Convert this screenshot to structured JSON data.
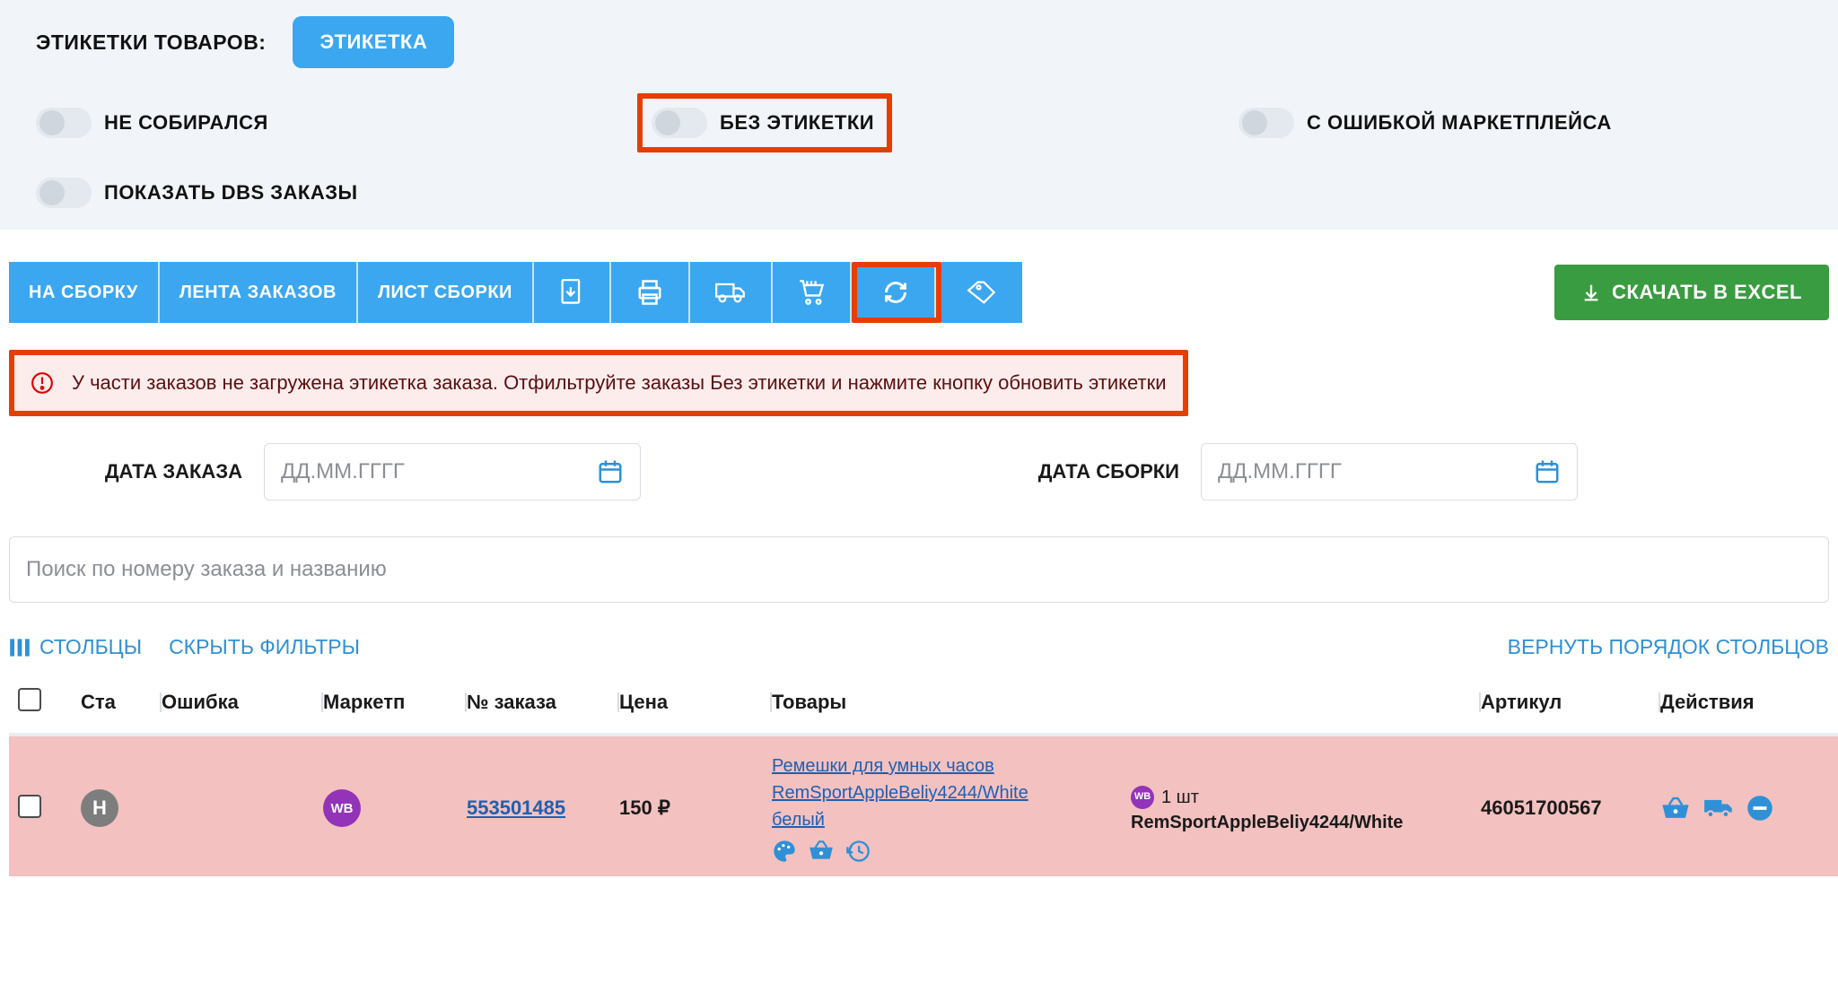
{
  "filters": {
    "labels_title": "ЭТИКЕТКИ ТОВАРОВ:",
    "label_button": "ЭТИКЕТКА",
    "toggle_not_assembled": "НЕ СОБИРАЛСЯ",
    "toggle_no_label": "БЕЗ ЭТИКЕТКИ",
    "toggle_mp_error": "С ОШИБКОЙ МАРКЕТПЛЕЙСА",
    "toggle_dbs": "ПОКАЗАТЬ DBS ЗАКАЗЫ"
  },
  "toolbar": {
    "to_assembly": "НА СБОРКУ",
    "orders_feed": "ЛЕНТА ЗАКАЗОВ",
    "assembly_list": "ЛИСТ СБОРКИ",
    "download_excel": "СКАЧАТЬ В EXCEL"
  },
  "alert": {
    "text": "У части заказов не загружена этикетка заказа. Отфильтруйте заказы Без этикетки и нажмите кнопку обновить этикетки"
  },
  "dates": {
    "order_label": "ДАТА ЗАКАЗА",
    "assembly_label": "ДАТА СБОРКИ",
    "placeholder": "ДД.ММ.ГГГГ"
  },
  "search": {
    "placeholder": "Поиск по номеру заказа и названию"
  },
  "table_controls": {
    "columns": "СТОЛБЦЫ",
    "hide_filters": "СКРЫТЬ ФИЛЬТРЫ",
    "reset_order": "ВЕРНУТЬ ПОРЯДОК СТОЛБЦОВ"
  },
  "columns": {
    "status": "Ста",
    "error": "Ошибка",
    "market": "Маркетп",
    "order": "№ заказа",
    "price": "Цена",
    "goods": "Товары",
    "article": "Артикул",
    "actions": "Действия"
  },
  "row": {
    "status_letter": "Н",
    "market_badge": "WB",
    "order_number": "553501485",
    "price": "150 ₽",
    "goods_line1": "Ремешки для умных часов",
    "goods_line2": "RemSportAppleBeliy4244/White",
    "goods_line3": "белый",
    "qty": "1 шт",
    "qty_sku": "RemSportAppleBeliy4244/White",
    "article": "46051700567"
  },
  "colors": {
    "blue": "#3ba7f0",
    "green": "#3a9c40",
    "red": "#e53e00",
    "link": "#2f90d6",
    "row_bg": "#f2c1c0",
    "wb": "#9333b8"
  }
}
